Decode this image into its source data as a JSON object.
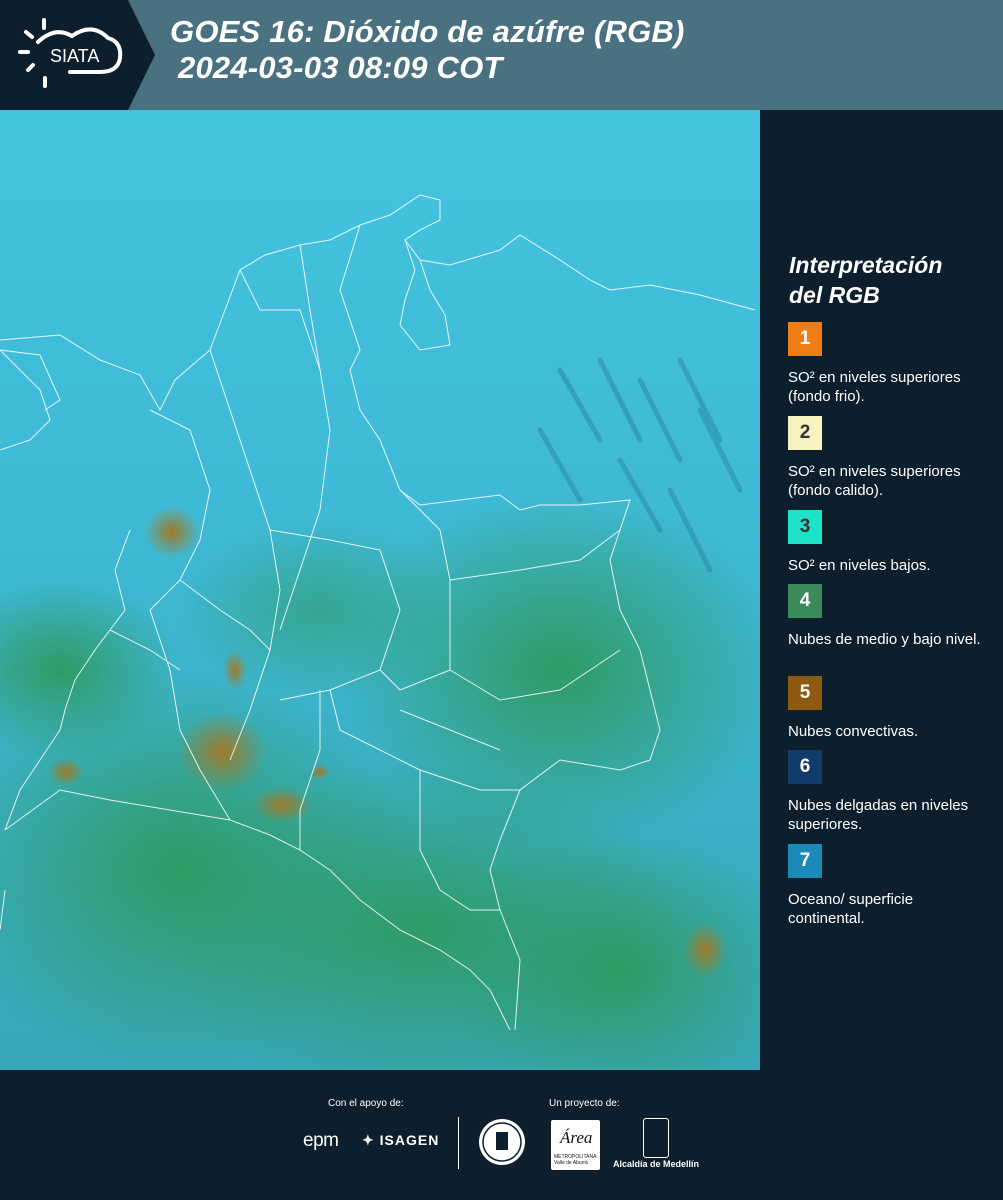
{
  "header": {
    "logo_text": "SIATA",
    "title_line1": "GOES 16: Dióxido de azúfre (RGB)",
    "title_line2": "2024-03-03 08:09 COT"
  },
  "legend": {
    "title_line1": "Interpretación",
    "title_line2": "del RGB",
    "items": [
      {
        "number": "1",
        "color": "#f07d13",
        "label": "SO² en niveles superiores (fondo frio)."
      },
      {
        "number": "2",
        "color": "#f7f2c0",
        "label": "SO² en niveles superiores (fondo calido)."
      },
      {
        "number": "3",
        "color": "#1de3c8",
        "label": "SO² en niveles bajos."
      },
      {
        "number": "4",
        "color": "#3b8a5a",
        "label": "Nubes de medio y bajo nivel."
      },
      {
        "number": "5",
        "color": "#8c5a10",
        "label": "Nubes convectivas."
      },
      {
        "number": "6",
        "color": "#123a6a",
        "label": "Nubes delgadas en niveles superiores."
      },
      {
        "number": "7",
        "color": "#1a8ab8",
        "label": "Oceano/ superficie continental."
      }
    ]
  },
  "footer": {
    "support_label": "Con el apoyo de:",
    "project_label": "Un proyecto de:",
    "sponsor1": "epm",
    "sponsor2": "ISAGEN",
    "area_text": "Área",
    "area_sub": "METROPOLITANA Valle de Aburrá",
    "alcaldia": "Alcaldía de Medellín"
  },
  "colors": {
    "background": "#0d1f2d",
    "header": "#4a7180",
    "ocean": "#3fb8d6",
    "land_green": "#2f9a6a",
    "convective": "#9a7a2a"
  },
  "icons": [
    "siata-sun-cloud-logo",
    "isagen-icon",
    "university-seal-icon",
    "alcaldia-building-icon"
  ]
}
